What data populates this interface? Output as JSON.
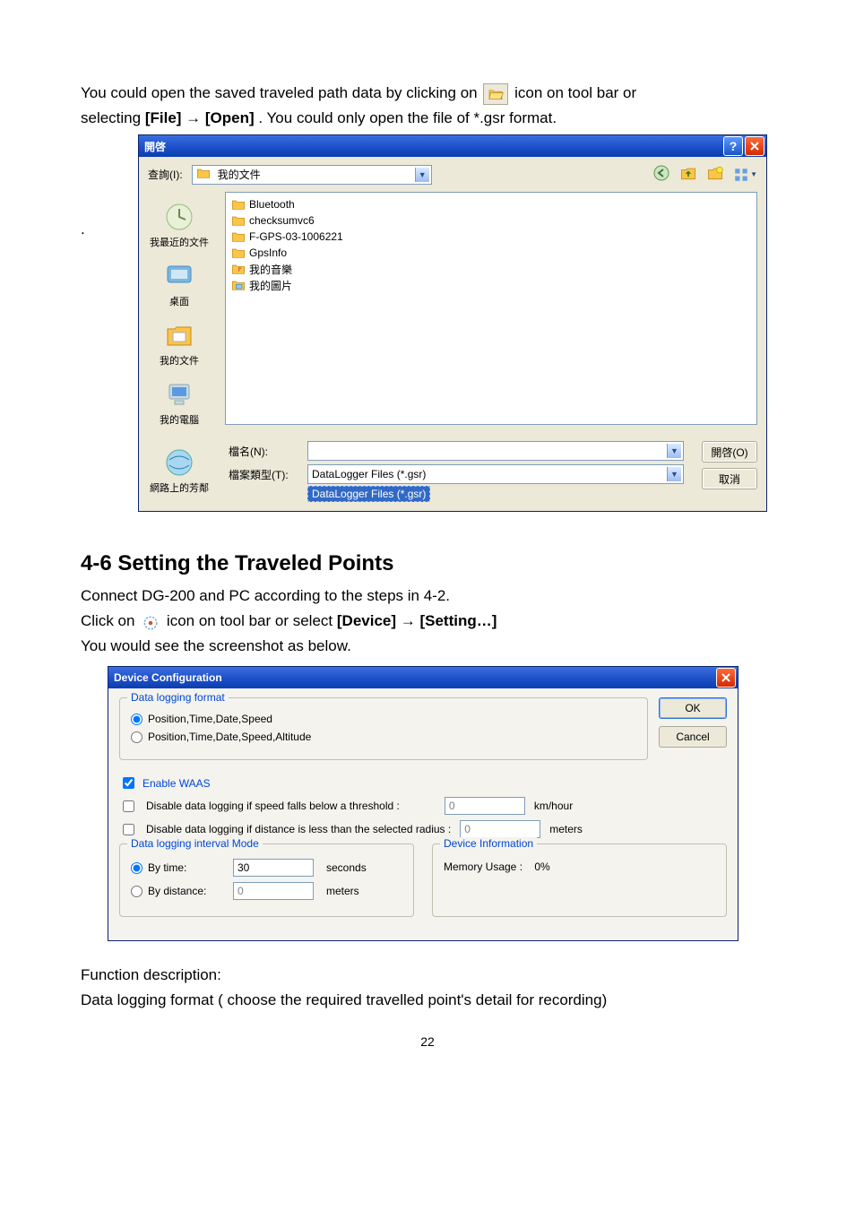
{
  "intro": {
    "line1_a": "You could open the saved traveled path data by clicking on ",
    "line1_b": " icon on tool bar or",
    "line2_a": "selecting ",
    "line2_bold": "[File] → [Open]",
    "line2_b": ". You could only open the file of *.gsr format."
  },
  "open_dialog": {
    "title": "開啓",
    "lookin_label": "查詢(I):",
    "lookin_value": "我的文件",
    "places": {
      "recent": "我最近的文件",
      "desktop": "桌面",
      "documents": "我的文件",
      "computer": "我的電腦",
      "network": "網路上的芳鄰"
    },
    "files": [
      "Bluetooth",
      "checksumvc6",
      "F-GPS-03-1006221",
      "GpsInfo",
      "我的音樂",
      "我的圖片"
    ],
    "filename_label": "檔名(N):",
    "filename_value": "",
    "filetype_label": "檔案類型(T):",
    "filetype_value": "DataLogger Files (*.gsr)",
    "filetype_option": "DataLogger Files (*.gsr)",
    "open_btn": "開啓(O)",
    "cancel_btn": "取消"
  },
  "heading": "4-6 Setting the Traveled Points",
  "after_heading": {
    "l1": "Connect DG-200 and PC according to the steps in 4-2.",
    "l2_a": "Click on ",
    "l2_b": " icon on tool bar or select ",
    "l2_bold": "[Device] → [Setting…]",
    "l3": "You would see the screenshot as below."
  },
  "devconf": {
    "title": "Device Configuration",
    "format_group": "Data logging format",
    "radio1": "Position,Time,Date,Speed",
    "radio2": "Position,Time,Date,Speed,Altitude",
    "ok": "OK",
    "cancel": "Cancel",
    "enable_waas": "Enable WAAS",
    "disable_speed": "Disable data logging if speed falls below a threshold :",
    "disable_speed_val": "0",
    "disable_speed_unit": "km/hour",
    "disable_dist": "Disable data logging if distance is less than the selected radius :",
    "disable_dist_val": "0",
    "disable_dist_unit": "meters",
    "interval_group": "Data logging interval Mode",
    "by_time_label": "By time:",
    "by_time_val": "30",
    "by_time_unit": "seconds",
    "by_dist_label": "By distance:",
    "by_dist_val": "0",
    "by_dist_unit": "meters",
    "devinfo_group": "Device Information",
    "mem_label": "Memory Usage :",
    "mem_val": "0%"
  },
  "footer": {
    "f1": "Function description:",
    "f2": "Data logging format ( choose the required travelled point's detail for recording)"
  },
  "pagenum": "22"
}
